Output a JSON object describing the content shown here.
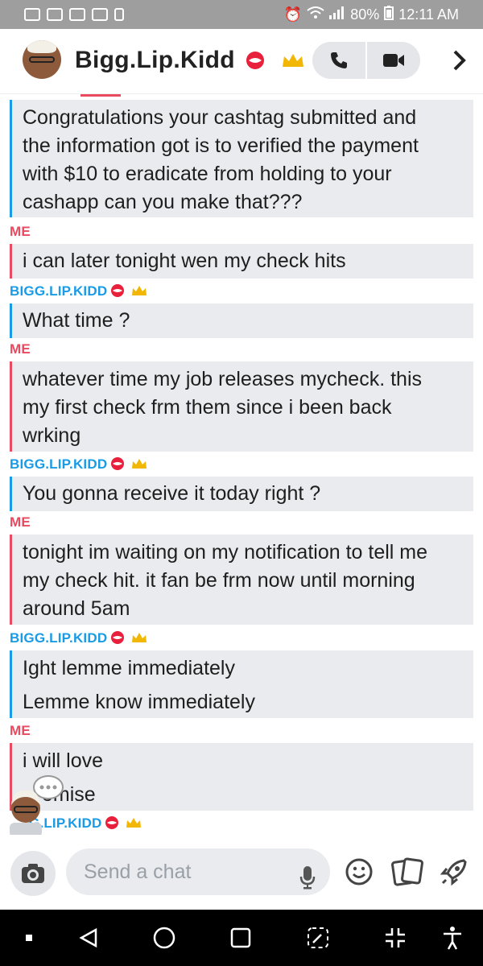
{
  "status_bar": {
    "battery": "80%",
    "time": "12:11 AM"
  },
  "header": {
    "title": "Bigg.Lip.Kidd"
  },
  "messages": [
    {
      "sender": "",
      "from": "them",
      "lines": [
        "Congratulations your cashtag submitted and",
        "the information got is to verified the payment",
        "with $10 to eradicate from holding to your",
        "cashapp can you make that???"
      ]
    },
    {
      "sender": "ME",
      "from": "me",
      "lines": [
        "i can later tonight wen my check hits"
      ]
    },
    {
      "sender": "BIGG.LIP.KIDD",
      "from": "them",
      "lines": [
        "What time ?"
      ]
    },
    {
      "sender": "ME",
      "from": "me",
      "lines": [
        "whatever time my job releases mycheck. this",
        "my first check frm them since i been back",
        "wrking"
      ]
    },
    {
      "sender": "BIGG.LIP.KIDD",
      "from": "them",
      "lines": [
        "You gonna receive it today right ?"
      ]
    },
    {
      "sender": "ME",
      "from": "me",
      "lines": [
        "tonight im waiting on my notification to tell me",
        "my check hit. it fan be frm now until morning",
        "around 5am"
      ]
    },
    {
      "sender": "BIGG.LIP.KIDD",
      "from": "them",
      "lines": [
        "Ight lemme immediately",
        "Lemme know immediately"
      ]
    },
    {
      "sender": "ME",
      "from": "me",
      "lines": [
        "i will love",
        "omise"
      ]
    },
    {
      "sender": "G.LIP.KIDD",
      "from": "them",
      "lines": []
    }
  ],
  "composer": {
    "placeholder": "Send a chat"
  },
  "icons": {
    "camera": "camera-icon",
    "mic": "microphone-icon",
    "emoji": "smiley-icon",
    "stickers": "sticker-icon",
    "games": "rocket-icon",
    "phone": "phone-icon",
    "video": "video-icon",
    "forward": "chevron-right-icon"
  },
  "colors": {
    "me": "#e84a5f",
    "them": "#1a9be5",
    "bubble": "#e9ebee",
    "status_bar": "#9e9e9e"
  }
}
